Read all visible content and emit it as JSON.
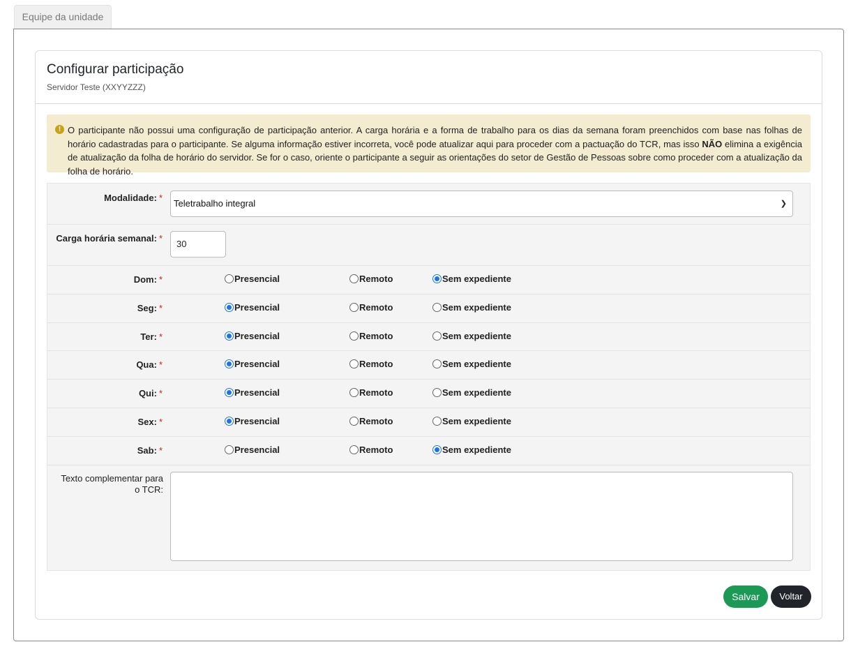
{
  "tab": {
    "label": "Equipe da unidade"
  },
  "card": {
    "title": "Configurar participação",
    "subtitle": "Servidor Teste (XXYYZZZ)"
  },
  "alert": {
    "icon": "exclamation-icon",
    "text_before": "O participante não possui uma configuração de participação anterior. A carga horária e a forma de trabalho para os dias da semana foram preenchidos com base nas folhas de horário cadastradas para o participante. Se alguma informação estiver incorreta, você pode atualizar aqui para proceder com a pactuação do TCR, mas isso ",
    "text_bold": "NÃO",
    "text_after": " elimina a exigência de atualização da folha de horário do servidor. Se for o caso, oriente o participante a seguir as orientações do setor de Gestão de Pessoas sobre como proceder com a atualização da folha de horário."
  },
  "form": {
    "required_mark": "*",
    "modalidade": {
      "label": "Modalidade:",
      "value": "Teletrabalho integral"
    },
    "carga": {
      "label": "Carga horária semanal:",
      "value": "30"
    },
    "options": {
      "presencial": "Presencial",
      "remoto": "Remoto",
      "sem": "Sem expediente"
    },
    "days": [
      {
        "label": "Dom:",
        "selected": "sem"
      },
      {
        "label": "Seg:",
        "selected": "presencial"
      },
      {
        "label": "Ter:",
        "selected": "presencial"
      },
      {
        "label": "Qua:",
        "selected": "presencial"
      },
      {
        "label": "Qui:",
        "selected": "presencial"
      },
      {
        "label": "Sex:",
        "selected": "presencial"
      },
      {
        "label": "Sab:",
        "selected": "sem"
      }
    ],
    "texto": {
      "label": "Texto complementar para o TCR:",
      "value": ""
    }
  },
  "buttons": {
    "save": "Salvar",
    "back": "Voltar"
  },
  "colors": {
    "save": "#1c9a55",
    "back": "#212529",
    "radio": "#1a73e8",
    "alert_bg": "#f3ecd0"
  }
}
